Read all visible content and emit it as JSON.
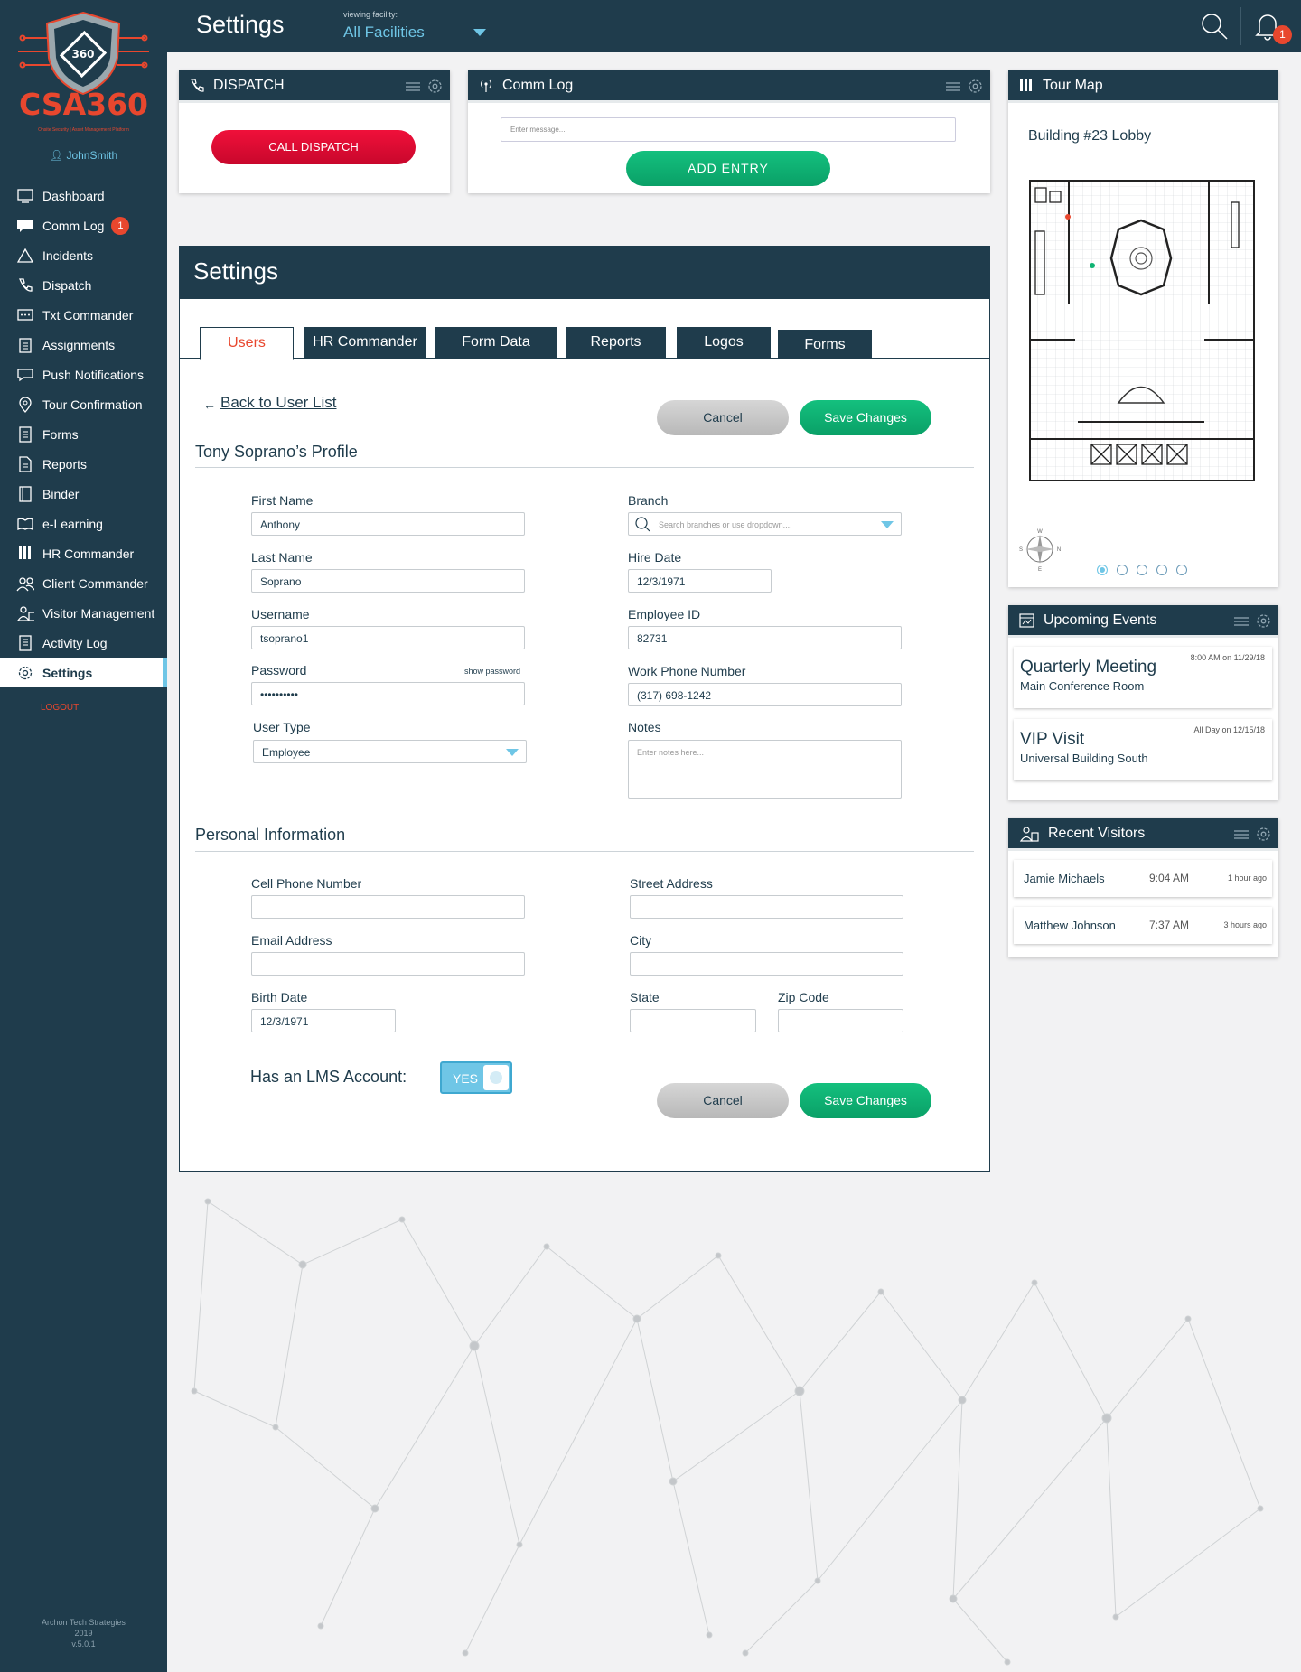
{
  "app": {
    "logo_text": "CSA360",
    "logo_tagline": "Onsite Security | Asset Management Platform",
    "user": "JohnSmith",
    "logout": "LOGOUT",
    "footer": [
      "Archon Tech Strategies",
      "2019",
      "v.5.0.1"
    ]
  },
  "sidebar": {
    "items": [
      {
        "label": "Dashboard",
        "icon": "dashboard-icon"
      },
      {
        "label": "Comm Log",
        "icon": "chat-icon",
        "badge": "1"
      },
      {
        "label": "Incidents",
        "icon": "warning-icon"
      },
      {
        "label": "Dispatch",
        "icon": "phone-icon"
      },
      {
        "label": "Txt Commander",
        "icon": "message-icon"
      },
      {
        "label": "Assignments",
        "icon": "clipboard-icon"
      },
      {
        "label": "Push Notifications",
        "icon": "notification-icon"
      },
      {
        "label": "Tour Confirmation",
        "icon": "location-pin-icon"
      },
      {
        "label": "Forms",
        "icon": "form-icon"
      },
      {
        "label": "Reports",
        "icon": "report-icon"
      },
      {
        "label": "Binder",
        "icon": "binder-icon"
      },
      {
        "label": "e-Learning",
        "icon": "book-icon"
      },
      {
        "label": "HR Commander",
        "icon": "hr-icon"
      },
      {
        "label": "Client Commander",
        "icon": "clients-icon"
      },
      {
        "label": "Visitor Management",
        "icon": "visitor-icon"
      },
      {
        "label": "Activity Log",
        "icon": "log-icon"
      },
      {
        "label": "Settings",
        "icon": "gear-icon",
        "active": true
      }
    ]
  },
  "header": {
    "title": "Settings",
    "facility_label": "viewing facility:",
    "facility_value": "All Facilities",
    "notification_count": "1"
  },
  "dispatch": {
    "title": "DISPATCH",
    "button": "CALL DISPATCH"
  },
  "comm_log": {
    "title": "Comm Log",
    "placeholder": "Enter message...",
    "button": "ADD  ENTRY"
  },
  "tour_map": {
    "title": "Tour Map",
    "location": "Building #23 Lobby",
    "compass": [
      "W",
      "N",
      "E",
      "S"
    ],
    "slides": 5,
    "active_slide": 1
  },
  "events": {
    "title": "Upcoming Events",
    "items": [
      {
        "title": "Quarterly Meeting",
        "location": "Main Conference Room",
        "when": "8:00 AM on 11/29/18"
      },
      {
        "title": "VIP Visit",
        "location": "Universal Building South",
        "when": "All Day on 12/15/18"
      }
    ]
  },
  "visitors": {
    "title": "Recent Visitors",
    "items": [
      {
        "name": "Jamie Michaels",
        "time": "9:04 AM",
        "ago": "1 hour ago"
      },
      {
        "name": "Matthew Johnson",
        "time": "7:37 AM",
        "ago": "3 hours ago"
      }
    ]
  },
  "settings": {
    "title": "Settings",
    "tabs": [
      "Users",
      "HR Commander",
      "Form Data",
      "Reports",
      "Logos",
      "Forms"
    ],
    "active_tab": "Users",
    "back_link": "Back to User List",
    "cancel": "Cancel",
    "save": "Save Changes",
    "profile_title": "Tony Soprano’s Profile",
    "fields": {
      "first_name": {
        "label": "First Name",
        "value": "Anthony"
      },
      "last_name": {
        "label": "Last Name",
        "value": "Soprano"
      },
      "username": {
        "label": "Username",
        "value": "tsoprano1"
      },
      "password": {
        "label": "Password",
        "value": "••••••••••",
        "show": "show password"
      },
      "user_type": {
        "label": "User Type",
        "value": "Employee"
      },
      "branch": {
        "label": "Branch",
        "placeholder": "Search branches or use dropdown...."
      },
      "hire_date": {
        "label": "Hire Date",
        "value": "12/3/1971"
      },
      "employee_id": {
        "label": "Employee ID",
        "value": "82731"
      },
      "work_phone": {
        "label": "Work Phone Number",
        "value": "(317) 698-1242"
      },
      "notes": {
        "label": "Notes",
        "placeholder": "Enter notes here..."
      }
    },
    "personal_title": "Personal Information",
    "personal": {
      "cell": {
        "label": "Cell Phone Number",
        "value": ""
      },
      "email": {
        "label": "Email Address",
        "value": ""
      },
      "birth": {
        "label": "Birth Date",
        "value": "12/3/1971"
      },
      "street": {
        "label": "Street Address",
        "value": ""
      },
      "city": {
        "label": "City",
        "value": ""
      },
      "state": {
        "label": "State",
        "value": ""
      },
      "zip": {
        "label": "Zip Code",
        "value": ""
      }
    },
    "lms_label": "Has an LMS Account:",
    "lms_value": "YES"
  },
  "colors": {
    "navy": "#1f3c4c",
    "accent": "#e8472e",
    "green": "#0fb373",
    "sky": "#6fc6e6",
    "red": "#e00d34"
  }
}
